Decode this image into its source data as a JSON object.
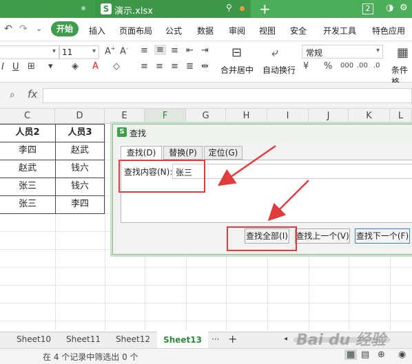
{
  "title_bar": {
    "file_tab": "演示.xlsx",
    "window_count": "2",
    "new_tab": "+"
  },
  "menu": {
    "items": [
      "开始",
      "插入",
      "页面布局",
      "公式",
      "数据",
      "审阅",
      "视图",
      "安全",
      "开发工具",
      "特色应用"
    ]
  },
  "toolbar": {
    "font_size": "11",
    "number_format": "常规",
    "merge_center": "合并居中",
    "wrap_text": "自动换行",
    "conditional_format": "条件格"
  },
  "formula_bar": {
    "fx": "fx"
  },
  "columns": [
    "C",
    "D",
    "E",
    "F",
    "G",
    "H",
    "I",
    "J",
    "K",
    "L"
  ],
  "table": {
    "headers": [
      "人员2",
      "人员3"
    ],
    "rows": [
      [
        "李四",
        "赵武"
      ],
      [
        "赵武",
        "钱六"
      ],
      [
        "张三",
        "钱六"
      ],
      [
        "张三",
        "李四"
      ]
    ]
  },
  "dialog": {
    "title": "查找",
    "tabs": [
      "查找(D)",
      "替换(P)",
      "定位(G)"
    ],
    "find_label": "查找内容(N):",
    "find_value": "张三",
    "buttons": {
      "find_all": "查找全部(I)",
      "find_prev": "查找上一个(V)",
      "find_next": "查找下一个(F)"
    }
  },
  "sheets": {
    "tabs": [
      "Sheet10",
      "Sheet11",
      "Sheet12"
    ],
    "active": "Sheet13",
    "more": "···",
    "add": "+"
  },
  "status": {
    "text": "在 4 个记录中筛选出 0 个"
  },
  "colors": {
    "accent": "#3f9d4b",
    "annotation": "#e23b3b"
  }
}
